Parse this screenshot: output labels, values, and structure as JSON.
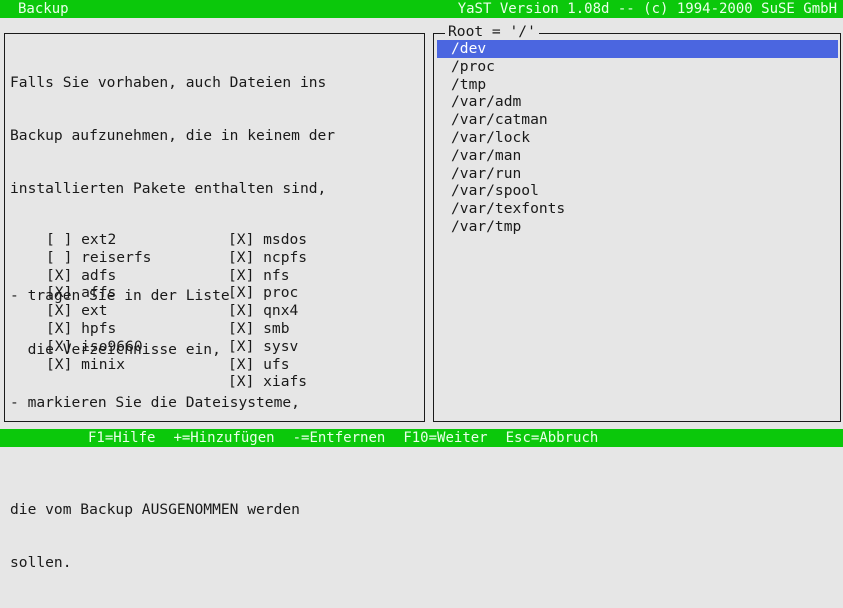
{
  "topbar": {
    "left_title": "Backup",
    "right_title": "YaST Version 1.08d -- (c) 1994-2000 SuSE GmbH"
  },
  "help": {
    "lines": [
      "Falls Sie vorhaben, auch Dateien ins",
      "Backup aufzunehmen, die in keinem der",
      "installierten Pakete enthalten sind,",
      "",
      "- tragen Sie in der Liste",
      "  die Verzeichnisse ein,",
      "- markieren Sie die Dateisysteme,",
      "",
      "die vom Backup AUSGENOMMEN werden",
      "sollen."
    ]
  },
  "filesystems": {
    "left": [
      {
        "mark": "[ ]",
        "name": "ext2"
      },
      {
        "mark": "[ ]",
        "name": "reiserfs"
      },
      {
        "mark": "[X]",
        "name": "adfs"
      },
      {
        "mark": "[X]",
        "name": "affs"
      },
      {
        "mark": "[X]",
        "name": "ext"
      },
      {
        "mark": "[X]",
        "name": "hpfs"
      },
      {
        "mark": "[X]",
        "name": "iso9660"
      },
      {
        "mark": "[X]",
        "name": "minix"
      }
    ],
    "right": [
      {
        "mark": "[X]",
        "name": "msdos"
      },
      {
        "mark": "[X]",
        "name": "ncpfs"
      },
      {
        "mark": "[X]",
        "name": "nfs"
      },
      {
        "mark": "[X]",
        "name": "proc"
      },
      {
        "mark": "[X]",
        "name": "qnx4"
      },
      {
        "mark": "[X]",
        "name": "smb"
      },
      {
        "mark": "[X]",
        "name": "sysv"
      },
      {
        "mark": "[X]",
        "name": "ufs"
      },
      {
        "mark": "[X]",
        "name": "xiafs"
      }
    ]
  },
  "root_panel": {
    "title": "Root = '/'",
    "directories": [
      "/dev",
      "/proc",
      "/tmp",
      "/var/adm",
      "/var/catman",
      "/var/lock",
      "/var/man",
      "/var/run",
      "/var/spool",
      "/var/texfonts",
      "/var/tmp"
    ],
    "selected": "/dev"
  },
  "bottombar": {
    "keys": [
      "F1=Hilfe",
      "+=Hinzufügen",
      "-=Entfernen",
      "F10=Weiter",
      "Esc=Abbruch"
    ]
  },
  "colors": {
    "bar_green": "#0bc80b",
    "selection_blue": "#4b66e0",
    "background": "#e6e6e6"
  }
}
